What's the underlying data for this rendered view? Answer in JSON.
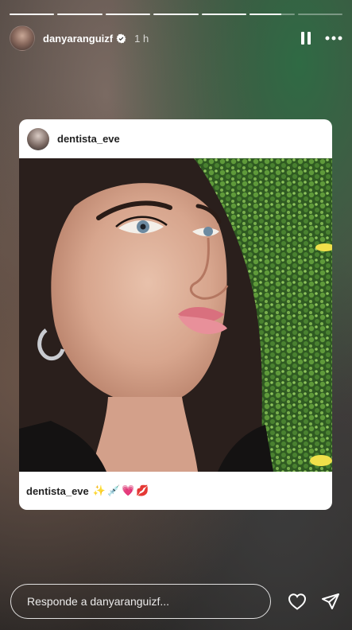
{
  "story": {
    "progress_segments": [
      1,
      1,
      1,
      1,
      1,
      0.7,
      0
    ],
    "username": "danyaranguizf",
    "time": "1 h",
    "verified": true
  },
  "post": {
    "username": "dentista_eve",
    "caption_user": "dentista_eve",
    "caption_emojis": "✨💉💗💋"
  },
  "reply": {
    "placeholder": "Responde a danyaranguizf..."
  },
  "icons": {
    "pause": "pause-icon",
    "more": "more-icon",
    "verified": "verified-badge-icon",
    "like": "heart-icon",
    "share": "send-icon"
  }
}
